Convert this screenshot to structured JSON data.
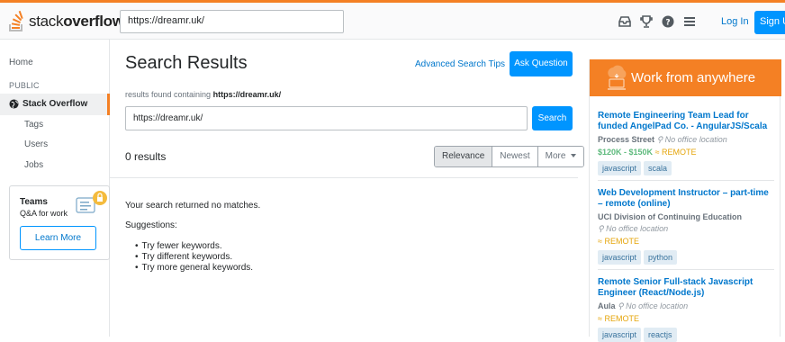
{
  "header": {
    "logo_light": "stack",
    "logo_bold": "overflow",
    "search_value": "https://dreamr.uk/",
    "icons": [
      "inbox-icon",
      "achievements-icon",
      "help-icon",
      "site-switcher-icon"
    ],
    "login_label": "Log In",
    "signup_label": "Sign Up"
  },
  "sidebar": {
    "home": "Home",
    "public": "PUBLIC",
    "stack_overflow": "Stack Overflow",
    "items": [
      {
        "label": "Tags"
      },
      {
        "label": "Users"
      },
      {
        "label": "Jobs"
      }
    ],
    "teams": {
      "title": "Teams",
      "subtitle": "Q&A for work",
      "button": "Learn More"
    }
  },
  "main": {
    "title": "Search Results",
    "advanced_link": "Advanced Search Tips",
    "ask_button": "Ask Question",
    "results_prefix": "results found containing",
    "results_query": "https://dreamr.uk/",
    "search_value": "https://dreamr.uk/",
    "search_button": "Search",
    "count": "0 results",
    "sort_tabs": [
      {
        "label": "Relevance",
        "active": true
      },
      {
        "label": "Newest",
        "active": false
      },
      {
        "label": "More",
        "active": false
      }
    ],
    "no_match": "Your search returned no matches.",
    "suggestions_label": "Suggestions:",
    "suggestions": [
      "Try fewer keywords.",
      "Try different keywords.",
      "Try more general keywords."
    ]
  },
  "jobs": {
    "header": "Work from anywhere",
    "listings": [
      {
        "title": "Remote Engineering Team Lead for funded AngelPad Co. - AngularJS/Scala",
        "company": "Process Street",
        "location": "No office location",
        "salary": "$120K - $150K",
        "remote": "REMOTE",
        "tags": [
          "javascript",
          "scala"
        ]
      },
      {
        "title": "Web Development Instructor – part-time – remote (online)",
        "company": "UCI Division of Continuing Education",
        "location": "No office location",
        "salary": "",
        "remote": "REMOTE",
        "tags": [
          "javascript",
          "python"
        ]
      },
      {
        "title": "Remote Senior Full-stack Javascript Engineer (React/Node.js)",
        "company": "Aula",
        "location": "No office location",
        "salary": "",
        "remote": "REMOTE",
        "tags": [
          "javascript",
          "reactjs"
        ]
      }
    ]
  },
  "colors": {
    "brand_orange": "#f48024",
    "primary_blue": "#0095ff",
    "link_blue": "#0077cc",
    "salary_green": "#5eba7d",
    "remote_yellow": "#e5a50a"
  }
}
